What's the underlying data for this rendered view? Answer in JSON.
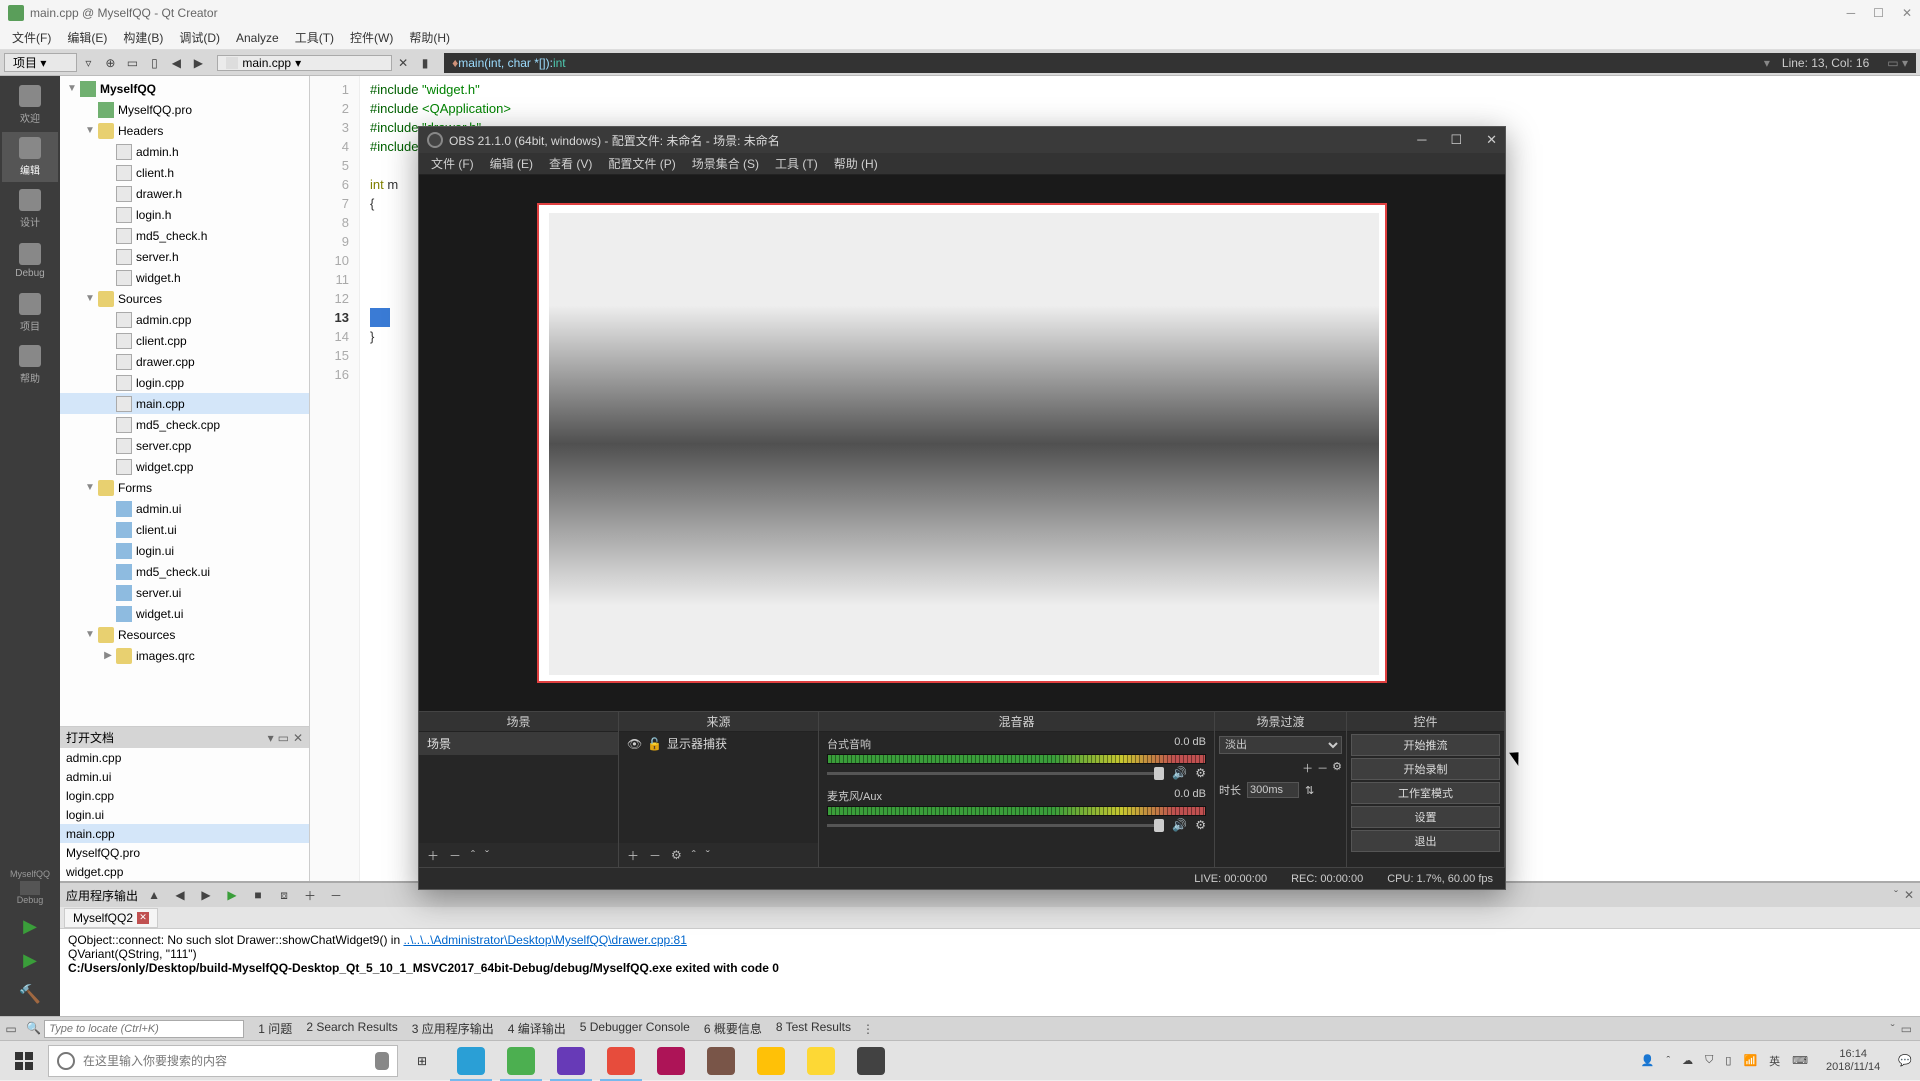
{
  "qt": {
    "title": "main.cpp @ MyselfQQ - Qt Creator",
    "menu": [
      "文件(F)",
      "编辑(E)",
      "构建(B)",
      "调试(D)",
      "Analyze",
      "工具(T)",
      "控件(W)",
      "帮助(H)"
    ],
    "project_combo": "项目",
    "file_combo": "main.cpp",
    "fn_sig_prefix": "main(int, char *[]): ",
    "fn_sig_ret": "int",
    "linecol": "Line: 13, Col: 16",
    "rail": [
      {
        "label": "欢迎"
      },
      {
        "label": "编辑",
        "active": true
      },
      {
        "label": "设计"
      },
      {
        "label": "Debug"
      },
      {
        "label": "项目"
      },
      {
        "label": "帮助"
      }
    ],
    "rail_target": {
      "name": "MyselfQQ",
      "mode": "Debug"
    },
    "tree": [
      {
        "d": 0,
        "arrow": "▼",
        "icon": "proj",
        "label": "MyselfQQ",
        "bold": true
      },
      {
        "d": 1,
        "arrow": "",
        "icon": "proj",
        "label": "MyselfQQ.pro"
      },
      {
        "d": 1,
        "arrow": "▼",
        "icon": "folder",
        "label": "Headers"
      },
      {
        "d": 2,
        "arrow": "",
        "icon": "h",
        "label": "admin.h"
      },
      {
        "d": 2,
        "arrow": "",
        "icon": "h",
        "label": "client.h"
      },
      {
        "d": 2,
        "arrow": "",
        "icon": "h",
        "label": "drawer.h"
      },
      {
        "d": 2,
        "arrow": "",
        "icon": "h",
        "label": "login.h"
      },
      {
        "d": 2,
        "arrow": "",
        "icon": "h",
        "label": "md5_check.h"
      },
      {
        "d": 2,
        "arrow": "",
        "icon": "h",
        "label": "server.h"
      },
      {
        "d": 2,
        "arrow": "",
        "icon": "h",
        "label": "widget.h"
      },
      {
        "d": 1,
        "arrow": "▼",
        "icon": "folder",
        "label": "Sources"
      },
      {
        "d": 2,
        "arrow": "",
        "icon": "cpp",
        "label": "admin.cpp"
      },
      {
        "d": 2,
        "arrow": "",
        "icon": "cpp",
        "label": "client.cpp"
      },
      {
        "d": 2,
        "arrow": "",
        "icon": "cpp",
        "label": "drawer.cpp"
      },
      {
        "d": 2,
        "arrow": "",
        "icon": "cpp",
        "label": "login.cpp"
      },
      {
        "d": 2,
        "arrow": "",
        "icon": "cpp",
        "label": "main.cpp",
        "sel": true
      },
      {
        "d": 2,
        "arrow": "",
        "icon": "cpp",
        "label": "md5_check.cpp"
      },
      {
        "d": 2,
        "arrow": "",
        "icon": "cpp",
        "label": "server.cpp"
      },
      {
        "d": 2,
        "arrow": "",
        "icon": "cpp",
        "label": "widget.cpp"
      },
      {
        "d": 1,
        "arrow": "▼",
        "icon": "folder",
        "label": "Forms"
      },
      {
        "d": 2,
        "arrow": "",
        "icon": "ui",
        "label": "admin.ui"
      },
      {
        "d": 2,
        "arrow": "",
        "icon": "ui",
        "label": "client.ui"
      },
      {
        "d": 2,
        "arrow": "",
        "icon": "ui",
        "label": "login.ui"
      },
      {
        "d": 2,
        "arrow": "",
        "icon": "ui",
        "label": "md5_check.ui"
      },
      {
        "d": 2,
        "arrow": "",
        "icon": "ui",
        "label": "server.ui"
      },
      {
        "d": 2,
        "arrow": "",
        "icon": "ui",
        "label": "widget.ui"
      },
      {
        "d": 1,
        "arrow": "▼",
        "icon": "folder",
        "label": "Resources"
      },
      {
        "d": 2,
        "arrow": "▶",
        "icon": "folder",
        "label": "images.qrc"
      }
    ],
    "open_docs_hdr": "打开文档",
    "open_docs": [
      {
        "label": "admin.cpp"
      },
      {
        "label": "admin.ui"
      },
      {
        "label": "login.cpp"
      },
      {
        "label": "login.ui"
      },
      {
        "label": "main.cpp",
        "sel": true
      },
      {
        "label": "MyselfQQ.pro"
      },
      {
        "label": "widget.cpp"
      }
    ],
    "code_lines": [
      "1",
      "2",
      "3",
      "4",
      "5",
      "6",
      "7",
      "8",
      "9",
      "10",
      "11",
      "12",
      "13",
      "14",
      "15",
      "16"
    ],
    "code_current": 13,
    "code": {
      "l1a": "#include ",
      "l1b": "\"widget.h\"",
      "l2a": "#include ",
      "l2b": "<QApplication>",
      "l3a": "#include ",
      "l3b": "\"drawer.h\"",
      "l4a": "#include ",
      "l4b": "",
      "l6a": "int ",
      "l6b": "m",
      "l7": "{",
      "l14": "}"
    },
    "output_hdr": "应用程序输出",
    "output_tab": "MyselfQQ2",
    "output": {
      "l1a": "QObject::connect: No such slot Drawer::showChatWidget9() in ",
      "l1b": "..\\..\\..\\Administrator\\Desktop\\MyselfQQ\\drawer.cpp:81",
      "l2": "QVariant(QString, \"111\")",
      "l3": "C:/Users/only/Desktop/build-MyselfQQ-Desktop_Qt_5_10_1_MSVC2017_64bit-Debug/debug/MyselfQQ.exe exited with code 0"
    },
    "search_placeholder": "Type to locate (Ctrl+K)",
    "status_tabs": [
      "1 问题",
      "2 Search Results",
      "3 应用程序输出",
      "4 编译输出",
      "5 Debugger Console",
      "6 概要信息",
      "8 Test Results"
    ]
  },
  "obs": {
    "title": "OBS 21.1.0 (64bit, windows) - 配置文件: 未命名 - 场景: 未命名",
    "menu": [
      "文件 (F)",
      "编辑 (E)",
      "查看 (V)",
      "配置文件 (P)",
      "场景集合 (S)",
      "工具 (T)",
      "帮助 (H)"
    ],
    "docks": {
      "scenes": "场景",
      "sources": "来源",
      "mixer": "混音器",
      "trans": "场景过渡",
      "ctrl": "控件"
    },
    "scene_item": "场景",
    "source_item": "显示器捕获",
    "mixer": [
      {
        "name": "台式音响",
        "db": "0.0 dB"
      },
      {
        "name": "麦克风/Aux",
        "db": "0.0 dB"
      }
    ],
    "trans_select": "淡出",
    "trans_dur_label": "时长",
    "trans_dur": "300ms",
    "ctrl_buttons": [
      "开始推流",
      "开始录制",
      "工作室模式",
      "设置",
      "退出"
    ],
    "status": {
      "live": "LIVE: 00:00:00",
      "rec": "REC: 00:00:00",
      "cpu": "CPU: 1.7%, 60.00 fps"
    }
  },
  "taskbar": {
    "search_placeholder": "在这里输入你要搜索的内容",
    "clock_time": "16:14",
    "clock_date": "2018/11/14",
    "ime": "英",
    "app_colors": [
      "#2a9fd6",
      "#4caf50",
      "#673ab7",
      "#e74c3c",
      "#ad1457",
      "#795548",
      "#ffc107",
      "#fdd835",
      "#424242"
    ]
  }
}
